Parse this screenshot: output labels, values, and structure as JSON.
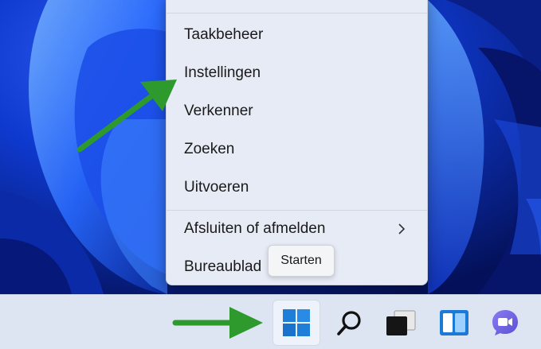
{
  "context_menu": {
    "items": [
      {
        "label": "Taakbeheer"
      },
      {
        "label": "Instellingen"
      },
      {
        "label": "Verkenner"
      },
      {
        "label": "Zoeken"
      },
      {
        "label": "Uitvoeren"
      },
      {
        "label": "Afsluiten of afmelden",
        "has_submenu": true
      },
      {
        "label": "Bureaublad"
      }
    ]
  },
  "tooltip": {
    "text": "Starten"
  },
  "taskbar": {
    "buttons": [
      {
        "name": "start",
        "icon": "windows-logo-icon",
        "active": true
      },
      {
        "name": "search",
        "icon": "search-icon"
      },
      {
        "name": "task-view",
        "icon": "task-view-icon"
      },
      {
        "name": "widgets",
        "icon": "widgets-icon"
      },
      {
        "name": "chat",
        "icon": "teams-chat-icon"
      }
    ]
  },
  "colors": {
    "menu_bg": "#e6ebf5",
    "taskbar_bg": "#dde5f3",
    "annotation_arrow": "#2e9a2e",
    "windows_blue": "#1f7fd8"
  }
}
